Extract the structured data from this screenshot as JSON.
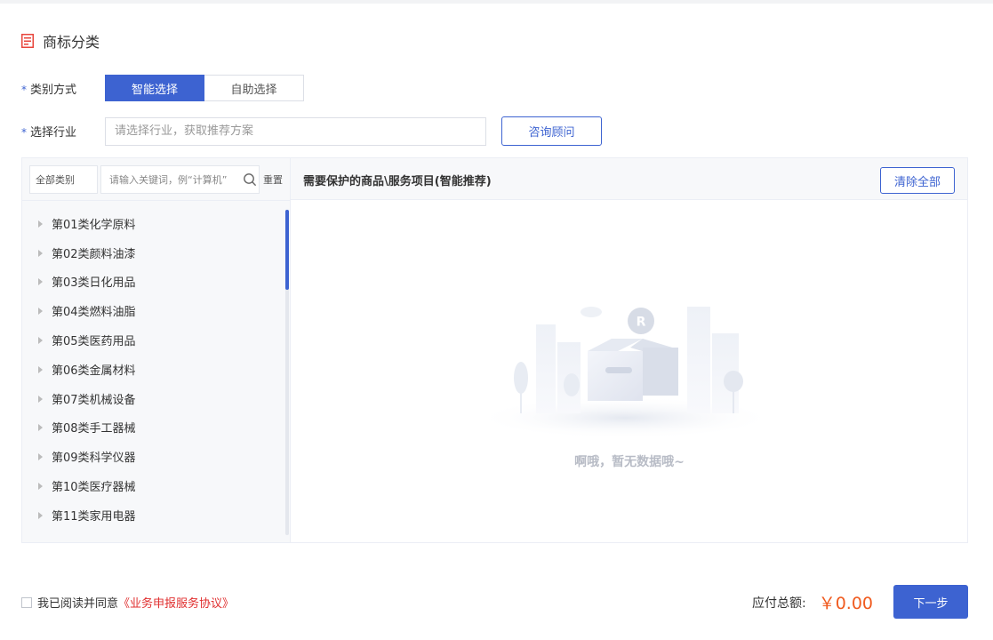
{
  "section": {
    "title": "商标分类"
  },
  "form": {
    "category_method": {
      "label": "类别方式",
      "required_mark": "*",
      "options": [
        {
          "label": "智能选择",
          "active": true
        },
        {
          "label": "自助选择",
          "active": false
        }
      ]
    },
    "industry": {
      "label": "选择行业",
      "required_mark": "*",
      "value": "",
      "placeholder": "请选择行业，获取推荐方案",
      "consult_button": "咨询顾问"
    }
  },
  "left_panel": {
    "category_select": "全部类别",
    "keyword_placeholder": "请输入关键词，例“计算机”",
    "reset": "重置",
    "categories": [
      "第01类化学原料",
      "第02类颜料油漆",
      "第03类日化用品",
      "第04类燃料油脂",
      "第05类医药用品",
      "第06类金属材料",
      "第07类机械设备",
      "第08类手工器械",
      "第09类科学仪器",
      "第10类医疗器械",
      "第11类家用电器"
    ]
  },
  "right_panel": {
    "title": "需要保护的商品\\服务项目(智能推荐)",
    "clear_all": "清除全部",
    "empty_text": "啊哦，暂无数据哦~"
  },
  "footer": {
    "agree_text": "我已阅读并同意",
    "agreement_link": "《业务申报服务协议》",
    "agreed": false,
    "total_label": "应付总额:",
    "total_amount": "￥0.00",
    "next_button": "下一步"
  },
  "colors": {
    "primary": "#3d63d1",
    "price": "#f05a1e",
    "link_red": "#e02f2f",
    "panel_bg": "#f7f8fa"
  }
}
